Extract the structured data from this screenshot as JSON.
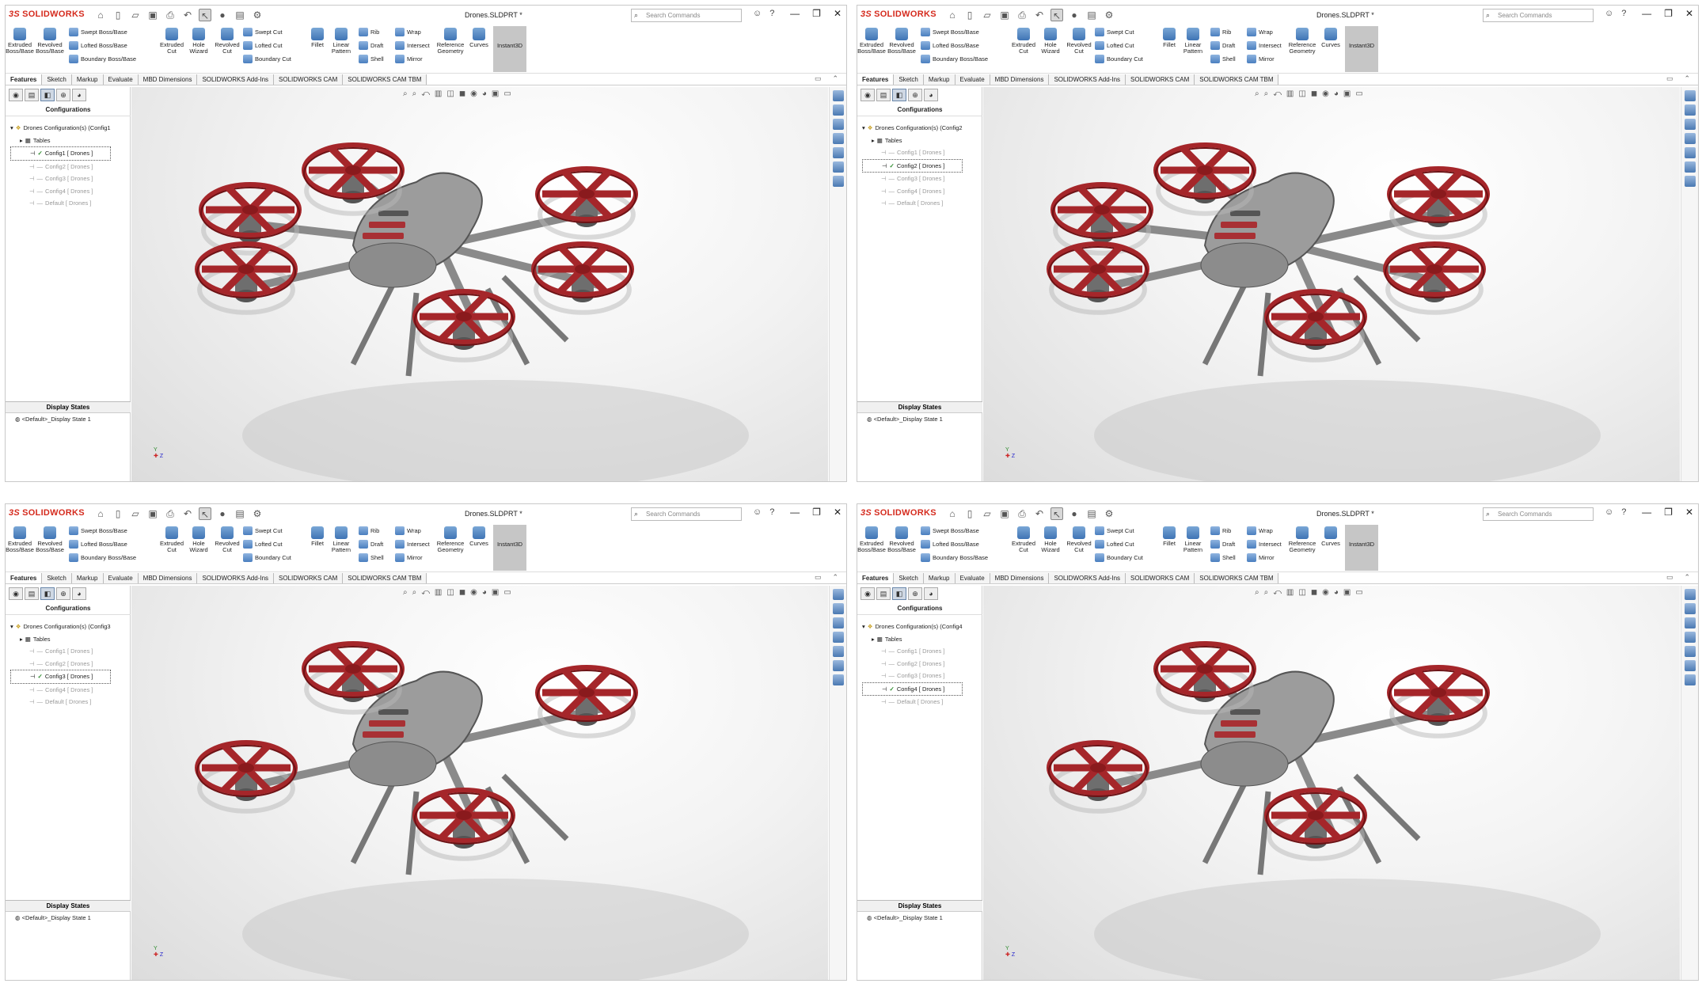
{
  "app": {
    "logo_text": "SOLIDWORKS",
    "doc_title": "Drones.SLDPRT *",
    "search_placeholder": "Search Commands"
  },
  "ribbon": {
    "extruded_boss": "Extruded Boss/Base",
    "revolved_boss": "Revolved Boss/Base",
    "swept_boss": "Swept Boss/Base",
    "lofted_boss": "Lofted Boss/Base",
    "boundary_boss": "Boundary Boss/Base",
    "extruded_cut": "Extruded Cut",
    "hole_wizard": "Hole Wizard",
    "revolved_cut": "Revolved Cut",
    "swept_cut": "Swept Cut",
    "lofted_cut": "Lofted Cut",
    "boundary_cut": "Boundary Cut",
    "fillet": "Fillet",
    "linear_pattern": "Linear Pattern",
    "rib": "Rib",
    "draft": "Draft",
    "shell": "Shell",
    "wrap": "Wrap",
    "intersect": "Intersect",
    "mirror": "Mirror",
    "reference_geometry": "Reference Geometry",
    "curves": "Curves",
    "instant3d": "Instant3D"
  },
  "tabs": [
    "Features",
    "Sketch",
    "Markup",
    "Evaluate",
    "MBD Dimensions",
    "SOLIDWORKS Add-Ins",
    "SOLIDWORKS CAM",
    "SOLIDWORKS CAM TBM"
  ],
  "panel": {
    "header": "Configurations",
    "tables": "Tables",
    "display_states": "Display States",
    "display_state_item": "<Default>_Display State 1"
  },
  "panes": [
    {
      "root": "Drones Configuration(s) (Config1",
      "configs": [
        "Config1 [ Drones ]",
        "Config2 [ Drones ]",
        "Config3 [ Drones ]",
        "Config4 [ Drones ]",
        "Default [ Drones ]"
      ],
      "active": 0
    },
    {
      "root": "Drones Configuration(s) (Config2",
      "configs": [
        "Config1 [ Drones ]",
        "Config2 [ Drones ]",
        "Config3 [ Drones ]",
        "Config4 [ Drones ]",
        "Default [ Drones ]"
      ],
      "active": 1
    },
    {
      "root": "Drones Configuration(s) (Config3",
      "configs": [
        "Config1 [ Drones ]",
        "Config2 [ Drones ]",
        "Config3 [ Drones ]",
        "Config4 [ Drones ]",
        "Default [ Drones ]"
      ],
      "active": 2
    },
    {
      "root": "Drones Configuration(s) (Config4",
      "configs": [
        "Config1 [ Drones ]",
        "Config2 [ Drones ]",
        "Config3 [ Drones ]",
        "Config4 [ Drones ]",
        "Default [ Drones ]"
      ],
      "active": 3
    }
  ],
  "colors": {
    "rotor": "#a5262a",
    "body": "#9c9c9c",
    "brand": "#d52b1e"
  }
}
